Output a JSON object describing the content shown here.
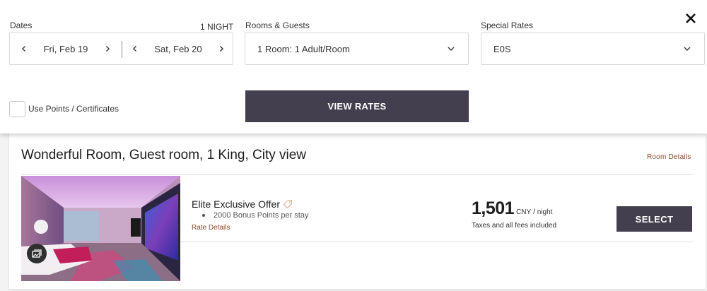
{
  "search": {
    "dates_label": "Dates",
    "nights": "1 NIGHT",
    "checkin": "Fri, Feb 19",
    "checkout": "Sat, Feb 20",
    "rooms_label": "Rooms & Guests",
    "rooms_value": "1 Room: 1 Adult/Room",
    "rates_label": "Special Rates",
    "rates_value": "E0S",
    "use_points_label": "Use Points / Certificates",
    "use_points_checked": false,
    "view_rates": "VIEW RATES",
    "close_icon": "close-icon"
  },
  "room": {
    "title": "Wonderful Room, Guest room, 1 King, City view",
    "details_link": "Room Details",
    "photo_badge_icon": "gallery-icon",
    "offer": {
      "title": "Elite Exclusive Offer",
      "tag_icon": "tag-icon",
      "bullet": "2000 Bonus Points per stay",
      "rate_details": "Rate Details"
    },
    "price": {
      "amount": "1,501",
      "currency": "CNY",
      "per_night": "/ night",
      "taxes": "Taxes and all fees included"
    },
    "select": "SELECT"
  },
  "colors": {
    "button_bg": "#433f4f",
    "link": "#8a4b2a"
  }
}
